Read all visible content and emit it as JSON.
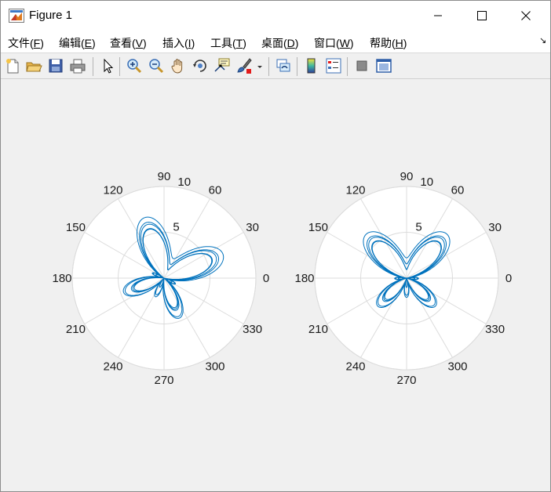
{
  "window": {
    "title": "Figure 1",
    "controls": {
      "minimize": "minimize",
      "maximize": "maximize",
      "close": "close"
    }
  },
  "menu": [
    {
      "label": "文件(",
      "key": "F",
      "suffix": ")"
    },
    {
      "label": "编辑(",
      "key": "E",
      "suffix": ")"
    },
    {
      "label": "查看(",
      "key": "V",
      "suffix": ")"
    },
    {
      "label": "插入(",
      "key": "I",
      "suffix": ")"
    },
    {
      "label": "工具(",
      "key": "T",
      "suffix": ")"
    },
    {
      "label": "桌面(",
      "key": "D",
      "suffix": ")"
    },
    {
      "label": "窗口(",
      "key": "W",
      "suffix": ")"
    },
    {
      "label": "帮助(",
      "key": "H",
      "suffix": ")"
    }
  ],
  "dock_glyph": "↘",
  "toolbar": [
    "new-figure-icon",
    "open-file-icon",
    "save-icon",
    "print-icon",
    "edit-plot-arrow-icon",
    "zoom-in-icon",
    "zoom-out-icon",
    "pan-hand-icon",
    "rotate-3d-icon",
    "data-cursor-icon",
    "brush-icon",
    "brush-dropdown-icon",
    "link-plot-icon",
    "colorbar-icon",
    "legend-icon",
    "hide-plot-tools-icon",
    "show-plot-tools-icon"
  ],
  "chart_data": [
    {
      "type": "polar-line",
      "angle_ticks": [
        "0",
        "30",
        "60",
        "90",
        "120",
        "150",
        "180",
        "210",
        "240",
        "270",
        "300",
        "330"
      ],
      "radial_ticks": [
        "5",
        "10"
      ],
      "rlim": [
        0,
        10
      ],
      "grid": true,
      "line_color": "#0072bd",
      "curve": "butterfly, lobes tilted toward 30° / 210° and 330°-300°",
      "rotation_deg": -25,
      "scale": 0.98
    },
    {
      "type": "polar-line",
      "angle_ticks": [
        "0",
        "30",
        "60",
        "90",
        "120",
        "150",
        "180",
        "210",
        "240",
        "270",
        "300",
        "330"
      ],
      "radial_ticks": [
        "5",
        "10"
      ],
      "rlim": [
        0,
        10
      ],
      "grid": true,
      "line_color": "#0072bd",
      "curve": "butterfly, wings up and down symmetric",
      "rotation_deg": 0,
      "scale": 0.92
    }
  ]
}
